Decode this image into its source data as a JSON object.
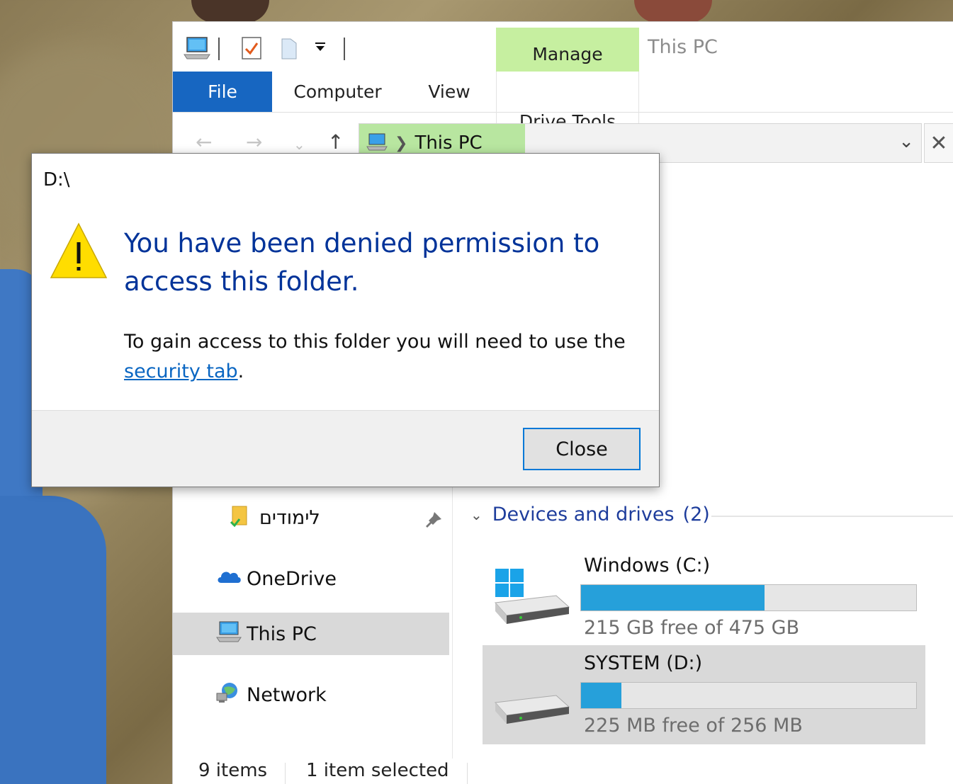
{
  "window": {
    "title": "This PC",
    "context_tab": "Manage"
  },
  "ribbon": {
    "tabs": [
      "File",
      "Computer",
      "View",
      "Drive Tools"
    ]
  },
  "address_bar": {
    "crumb": "This PC"
  },
  "nav_pane": {
    "items": [
      {
        "label": "לימודים",
        "icon": "folder-icon",
        "pinned": true
      },
      {
        "label": "OneDrive",
        "icon": "onedrive-cloud-icon"
      },
      {
        "label": "This PC",
        "icon": "computer-icon",
        "selected": true
      },
      {
        "label": "Network",
        "icon": "network-icon"
      }
    ]
  },
  "content": {
    "section_title": "Devices and drives",
    "section_count": "(2)",
    "drives": [
      {
        "name": "Windows (C:)",
        "free_text": "215 GB free of 475 GB",
        "used_fraction": 0.547,
        "icon": "windows-drive-icon",
        "selected": false
      },
      {
        "name": "SYSTEM (D:)",
        "free_text": "225 MB free of 256 MB",
        "used_fraction": 0.121,
        "icon": "drive-icon",
        "selected": true
      }
    ]
  },
  "status_bar": {
    "items_count": "9 items",
    "selection": "1 item selected"
  },
  "dialog": {
    "title": "D:\\",
    "heading": "You have been denied permission to access this folder.",
    "body_prefix": "To gain access to this folder you will need to use the ",
    "link_text": "security tab",
    "body_suffix": ".",
    "close_label": "Close"
  },
  "colors": {
    "accent_file_tab": "#1766c1",
    "manage_tab": "#c6efa0",
    "heading_blue": "#003399",
    "drive_bar": "#26a0da"
  }
}
